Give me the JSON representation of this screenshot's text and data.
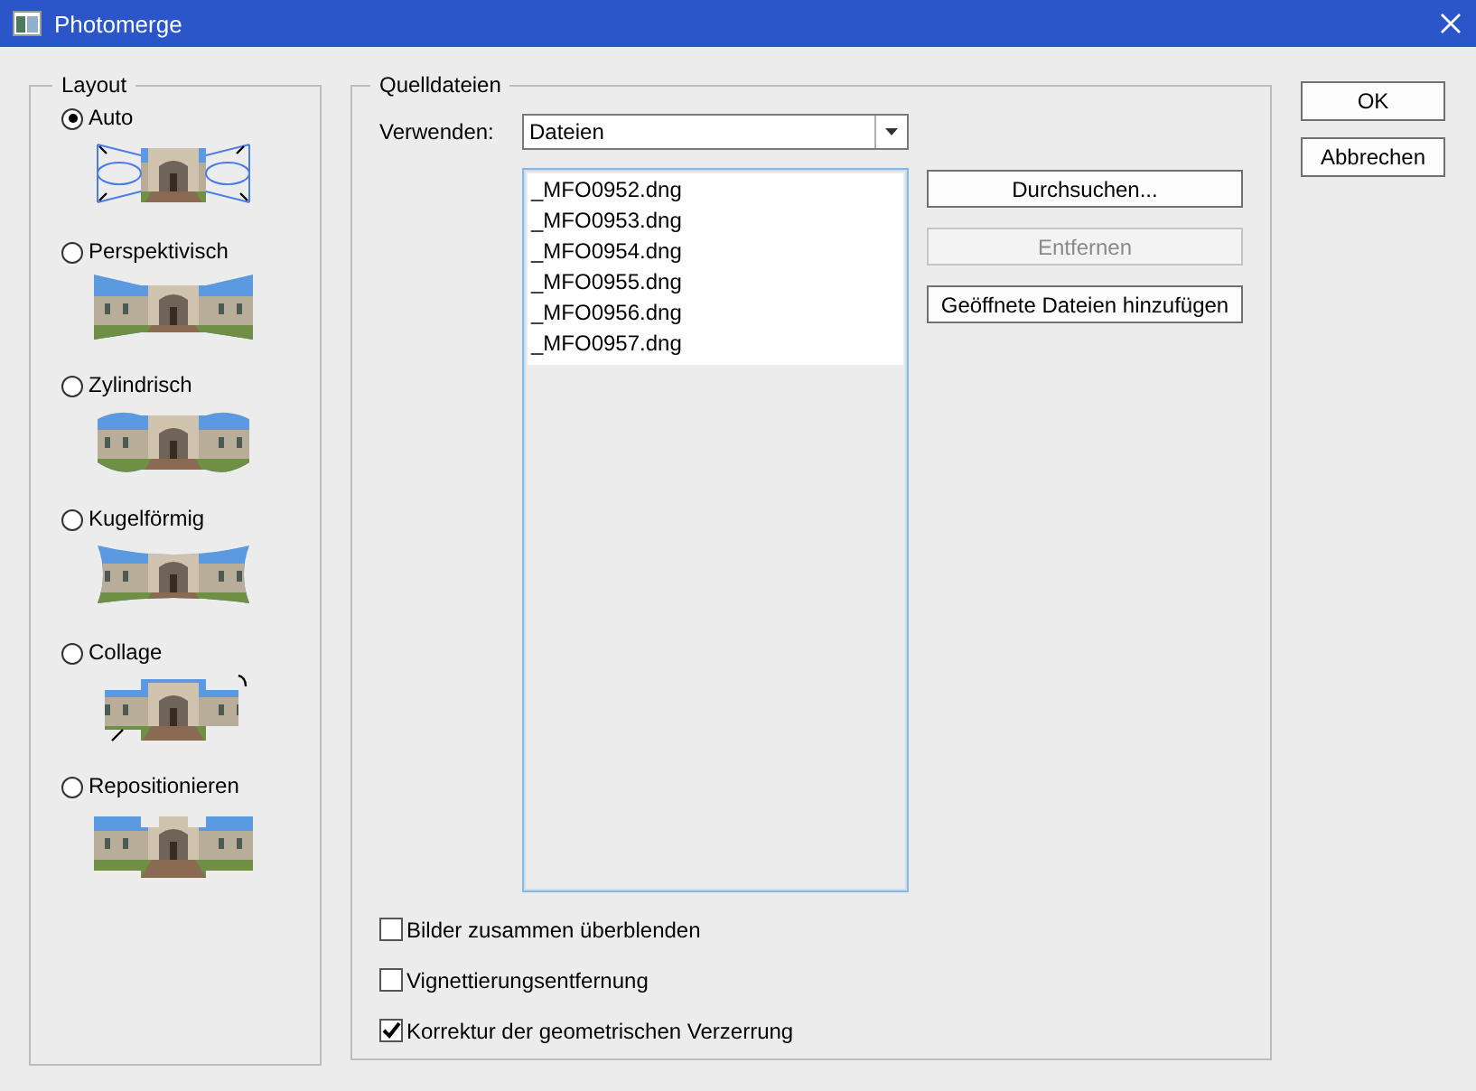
{
  "window": {
    "title": "Photomerge"
  },
  "layout": {
    "title": "Layout",
    "options": [
      {
        "label": "Auto",
        "kind": "auto",
        "selected": true
      },
      {
        "label": "Perspektivisch",
        "kind": "perspective",
        "selected": false
      },
      {
        "label": "Zylindrisch",
        "kind": "cylindrical",
        "selected": false
      },
      {
        "label": "Kugelförmig",
        "kind": "spherical",
        "selected": false
      },
      {
        "label": "Collage",
        "kind": "collage",
        "selected": false
      },
      {
        "label": "Repositionieren",
        "kind": "reposition",
        "selected": false
      }
    ]
  },
  "source": {
    "title": "Quelldateien",
    "use_label": "Verwenden:",
    "use_value": "Dateien",
    "files": [
      "_MFO0952.dng",
      "_MFO0953.dng",
      "_MFO0954.dng",
      "_MFO0955.dng",
      "_MFO0956.dng",
      "_MFO0957.dng"
    ],
    "buttons": [
      {
        "label": "Durchsuchen...",
        "disabled": false
      },
      {
        "label": "Entfernen",
        "disabled": true
      },
      {
        "label": "Geöffnete Dateien hinzufügen",
        "disabled": false
      }
    ],
    "options": [
      {
        "label": "Bilder zusammen überblenden",
        "checked": false
      },
      {
        "label": "Vignettierungsentfernung",
        "checked": false
      },
      {
        "label": "Korrektur der geometrischen Verzerrung",
        "checked": true
      }
    ]
  },
  "buttons": [
    {
      "label": "OK"
    },
    {
      "label": "Abbrechen"
    }
  ]
}
